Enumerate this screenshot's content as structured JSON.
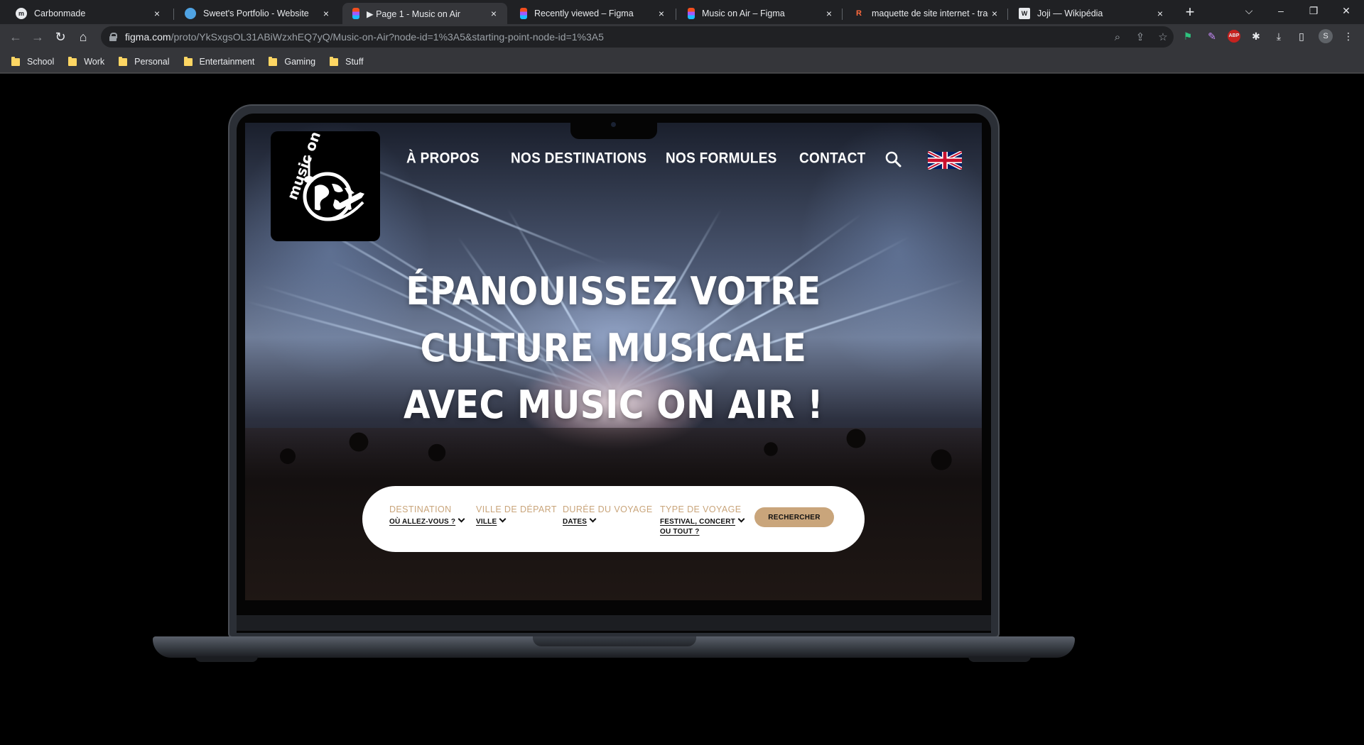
{
  "browser": {
    "tabs": [
      {
        "title": "Carbonmade",
        "favicon_color": "#e8eaed",
        "active": false
      },
      {
        "title": "Sweet's Portfolio - Website",
        "favicon_color": "#4fa3e3",
        "active": false
      },
      {
        "title": "▶ Page 1 - Music on Air",
        "favicon_color": "#f24e1e",
        "active": true
      },
      {
        "title": "Recently viewed – Figma",
        "favicon_color": "#f24e1e",
        "active": false
      },
      {
        "title": "Music on Air – Figma",
        "favicon_color": "#f24e1e",
        "active": false
      },
      {
        "title": "maquette de site internet - tradu",
        "favicon_color": "#ff6a3d",
        "active": false
      },
      {
        "title": "Joji — Wikipédia",
        "favicon_color": "#e8eaed",
        "active": false
      }
    ],
    "close_glyph": "×",
    "new_tab_glyph": "+",
    "url_host": "figma.com",
    "url_path": "/proto/YkSxgsOL31ABiWzxhEQ7yQ/Music-on-Air?node-id=1%3A5&starting-point-node-id=1%3A5",
    "bookmarks": [
      "School",
      "Work",
      "Personal",
      "Entertainment",
      "Gaming",
      "Stuff"
    ],
    "profile_initial": "S",
    "abp_label": "ABP"
  },
  "site": {
    "logo_text": "music on air",
    "nav": [
      "À PROPOS",
      "NOS DESTINATIONS",
      "NOS FORMULES",
      "CONTACT"
    ],
    "hero_lines": [
      "ÉPANOUISSEZ VOTRE",
      "CULTURE MUSICALE",
      "AVEC MUSIC ON AIR !"
    ],
    "search": {
      "fields": [
        {
          "label": "DESTINATION",
          "value": "OÙ ALLEZ-VOUS ?"
        },
        {
          "label": "VILLE DE DÉPART",
          "value": "VILLE"
        },
        {
          "label": "DURÉE DU VOYAGE",
          "value": "DATES"
        },
        {
          "label": "TYPE DE VOYAGE",
          "value_line1": "FESTIVAL, CONCERT",
          "value_line2": "OU TOUT ?"
        }
      ],
      "button": "RECHERCHER"
    },
    "colors": {
      "accent": "#c9a57b",
      "searchbar": "#ffffff",
      "nav_text": "#ffffff"
    }
  }
}
